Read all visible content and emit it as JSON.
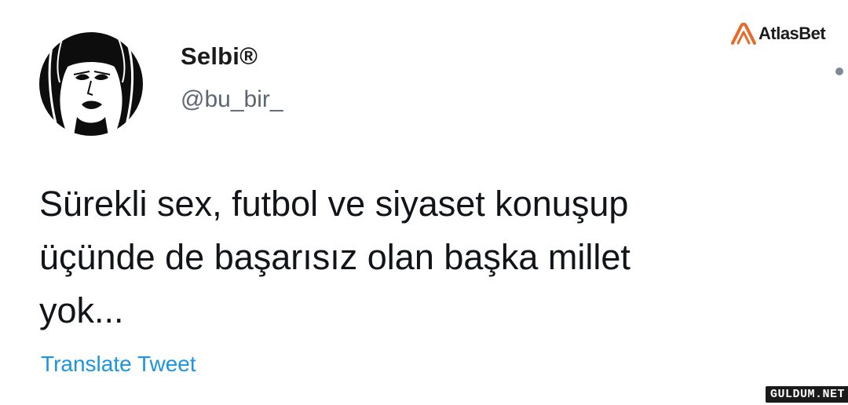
{
  "user": {
    "display_name": "Selbi®",
    "handle": "@bu_bir_",
    "avatar_icon": "avatar-portrait"
  },
  "tweet": {
    "text": "Sürekli sex, futbol ve siyaset konuşup\nüçünde de başarısız olan başka millet\nyok...",
    "translate_label": "Translate Tweet"
  },
  "menu": {
    "icon": "more-options-icon"
  },
  "watermarks": {
    "brand_text": "AtlasBet",
    "site_text": "GULDUM.NET"
  },
  "colors": {
    "link": "#1b95e0",
    "handle": "#5b6670",
    "text": "#111418",
    "brand_accent": "#e8692a"
  }
}
